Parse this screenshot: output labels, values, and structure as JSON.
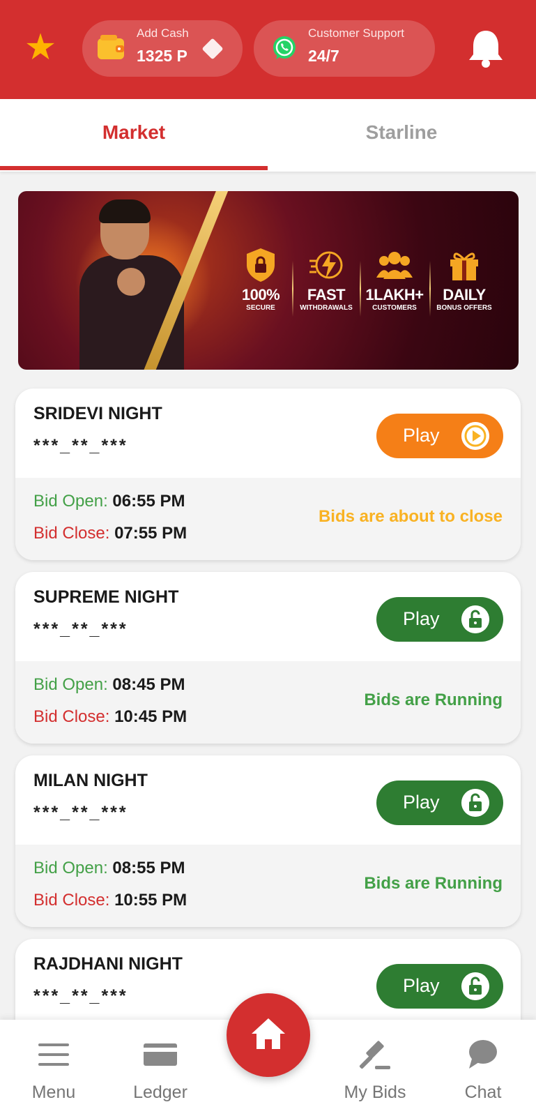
{
  "header": {
    "wallet": {
      "label": "Add Cash",
      "amount": "1325 P"
    },
    "support": {
      "label": "Customer Support",
      "value": "24/7"
    }
  },
  "tabs": [
    {
      "label": "Market",
      "active": true
    },
    {
      "label": "Starline",
      "active": false
    }
  ],
  "banner": {
    "features": [
      {
        "title": "100%",
        "subtitle": "SECURE",
        "icon": "shield-lock-icon"
      },
      {
        "title": "FAST",
        "subtitle": "WITHDRAWALS",
        "icon": "lightning-icon"
      },
      {
        "title": "1LAKH+",
        "subtitle": "CUSTOMERS",
        "icon": "users-icon"
      },
      {
        "title": "DAILY",
        "subtitle": "BONUS OFFERS",
        "icon": "gift-icon"
      }
    ]
  },
  "markets": [
    {
      "name": "SRIDEVI NIGHT",
      "result": "***_**_***",
      "play_label": "Play",
      "play_icon": "play-icon",
      "bid_open_label": "Bid Open:",
      "bid_open_time": "06:55 PM",
      "bid_close_label": "Bid Close:",
      "bid_close_time": "07:55 PM",
      "status": "Bids are about to close"
    },
    {
      "name": "SUPREME NIGHT",
      "result": "***_**_***",
      "play_label": "Play",
      "play_icon": "unlock-icon",
      "bid_open_label": "Bid Open:",
      "bid_open_time": "08:45 PM",
      "bid_close_label": "Bid Close:",
      "bid_close_time": "10:45 PM",
      "status": "Bids are Running"
    },
    {
      "name": "MILAN NIGHT",
      "result": "***_**_***",
      "play_label": "Play",
      "play_icon": "unlock-icon",
      "bid_open_label": "Bid Open:",
      "bid_open_time": "08:55 PM",
      "bid_close_label": "Bid Close:",
      "bid_close_time": "10:55 PM",
      "status": "Bids are Running"
    },
    {
      "name": "RAJDHANI NIGHT",
      "result": "***_**_***",
      "play_label": "Play",
      "play_icon": "unlock-icon"
    }
  ],
  "bottom_nav": {
    "menu": "Menu",
    "ledger": "Ledger",
    "my_bids": "My Bids",
    "chat": "Chat"
  },
  "colors": {
    "primary": "#d32f2f",
    "play_orange": "#f57f17",
    "play_green": "#2e7d32",
    "open_green": "#43a047",
    "warning": "#f9b223"
  }
}
